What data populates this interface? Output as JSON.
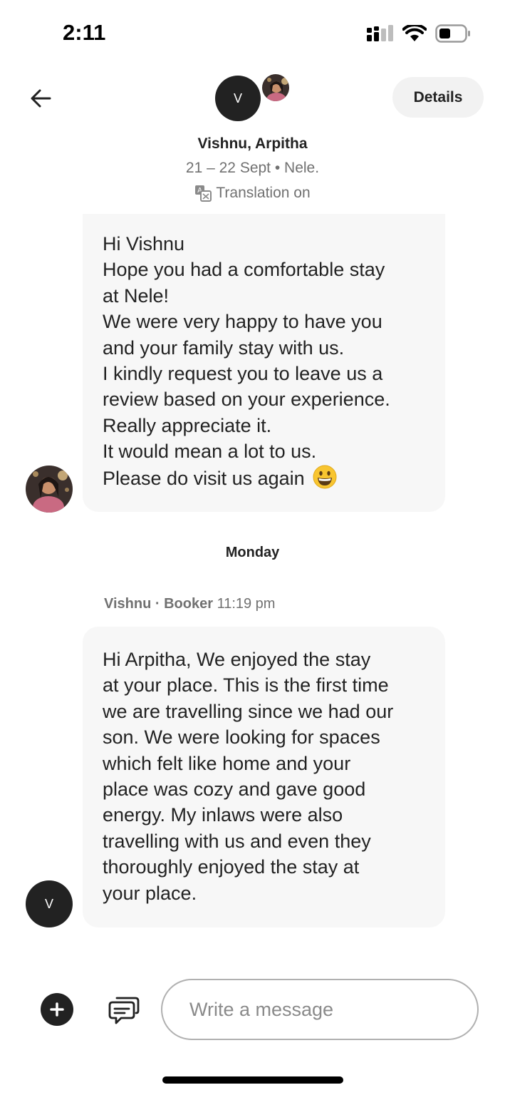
{
  "status_bar": {
    "time": "2:11",
    "icons": [
      "signal-icon",
      "wifi-icon",
      "battery-icon"
    ]
  },
  "header": {
    "back_icon": "arrow-left-icon",
    "avatar_initial": "V",
    "details_label": "Details",
    "participants": "Vishnu, Arpitha",
    "trip_info": "21 – 22 Sept • Nele.",
    "translation_label": "Translation on",
    "translation_icon": "translate-icon"
  },
  "messages": [
    {
      "sender": "host",
      "lines": [
        "Hi Vishnu",
        "Hope you had a comfortable stay",
        "at Nele!",
        "We were very happy to have you",
        "and your family stay with us.",
        "I kindly request you to leave us a",
        "review based on your experience.",
        "Really appreciate it.",
        "It would mean a lot to us.",
        "Please do visit us again"
      ],
      "emoji": "grinning-face-emoji"
    },
    {
      "day_divider": "Monday",
      "sender_name": "Vishnu",
      "sender_role": "· Booker",
      "time": "11:19 pm",
      "avatar_initial": "V",
      "lines": [
        "Hi Arpitha, We enjoyed the stay",
        "at your place. This is the first time",
        "we are travelling since we had our",
        "son. We were looking for spaces",
        "which felt like home and your",
        "place was cozy and gave good",
        "energy. My inlaws were also",
        "travelling with us and even they",
        "thoroughly enjoyed the stay at",
        "your place."
      ]
    }
  ],
  "composer": {
    "add_icon": "plus-icon",
    "quick_reply_icon": "chat-bubbles-icon",
    "placeholder": "Write a message"
  }
}
